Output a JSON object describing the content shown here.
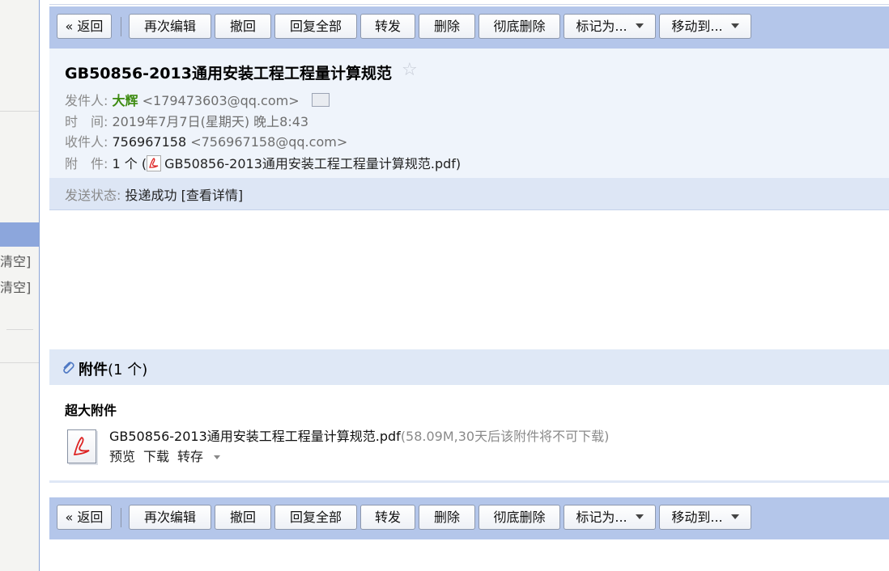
{
  "sidebar": {
    "clear_link_1": "清空]",
    "clear_link_2": "清空]"
  },
  "toolbar": {
    "back": "« 返回",
    "edit_again": "再次编辑",
    "recall": "撤回",
    "reply_all": "回复全部",
    "forward": "转发",
    "delete": "删除",
    "delete_permanently": "彻底删除",
    "mark_as": "标记为...",
    "move_to": "移动到..."
  },
  "email": {
    "subject": "GB50856-2013通用安装工程工程量计算规范",
    "from_label": "发件人:",
    "from_name": "大辉",
    "from_address": "<179473603@qq.com>",
    "time_label": "时　间:",
    "time_value": "2019年7月7日(星期天) 晚上8:43",
    "to_label": "收件人:",
    "to_name": "756967158",
    "to_address": "<756967158@qq.com>",
    "attach_label": "附　件:",
    "attach_count": "1 个 (",
    "attach_file": "GB50856-2013通用安装工程工程量计算规范.pdf",
    "attach_close": ")",
    "status_label": "发送状态:",
    "status_value": "投递成功",
    "status_detail": "[查看详情]"
  },
  "attachments": {
    "title": "附件",
    "count": "(1 个)",
    "big_label": "超大附件",
    "file_name": "GB50856-2013通用安装工程工程量计算规范.pdf",
    "file_meta": "(58.09M,30天后该附件将不可下载)",
    "preview": "预览",
    "download": "下载",
    "save_to": "转存"
  },
  "colors": {
    "toolbar_bg": "#b4c6ea",
    "header_bg": "#eff4fb",
    "sender_green": "#3d8b11"
  }
}
